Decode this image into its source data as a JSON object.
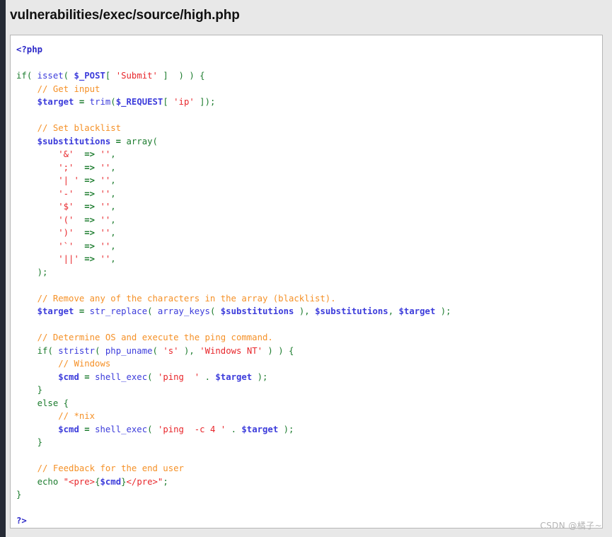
{
  "page": {
    "title": "vulnerabilities/exec/source/high.php",
    "watermark": "CSDN @橘子~"
  },
  "colors": {
    "page_background": "#e8e8e8",
    "left_rail": "#252a35",
    "code_background": "#ffffff",
    "code_border": "#b6b6b6",
    "title_text": "#111111",
    "token_tag": "#2b28c8",
    "token_keyword": "#1c7c2e",
    "token_function": "#3c3cdb",
    "token_variable": "#3c3cdb",
    "token_string": "#e8272c",
    "token_comment": "#f59128",
    "watermark": "#b4b4b4"
  },
  "code": {
    "language": "php",
    "file_name": "high.php",
    "lines": [
      [
        {
          "t": "<?php",
          "c": "tag"
        }
      ],
      [],
      [
        {
          "t": "if",
          "c": "kw"
        },
        {
          "t": "( ",
          "c": "pun"
        },
        {
          "t": "isset",
          "c": "fn"
        },
        {
          "t": "( ",
          "c": "pun"
        },
        {
          "t": "$_POST",
          "c": "var"
        },
        {
          "t": "[ ",
          "c": "pun"
        },
        {
          "t": "'Submit'",
          "c": "str"
        },
        {
          "t": " ]  ) ) {",
          "c": "pun"
        }
      ],
      [
        {
          "t": "    ",
          "c": "plain"
        },
        {
          "t": "// Get input",
          "c": "com"
        }
      ],
      [
        {
          "t": "    ",
          "c": "plain"
        },
        {
          "t": "$target",
          "c": "var"
        },
        {
          "t": " = ",
          "c": "op"
        },
        {
          "t": "trim",
          "c": "fn"
        },
        {
          "t": "(",
          "c": "pun"
        },
        {
          "t": "$_REQUEST",
          "c": "var"
        },
        {
          "t": "[ ",
          "c": "pun"
        },
        {
          "t": "'ip'",
          "c": "str"
        },
        {
          "t": " ]);",
          "c": "pun"
        }
      ],
      [],
      [
        {
          "t": "    ",
          "c": "plain"
        },
        {
          "t": "// Set blacklist",
          "c": "com"
        }
      ],
      [
        {
          "t": "    ",
          "c": "plain"
        },
        {
          "t": "$substitutions",
          "c": "var"
        },
        {
          "t": " = ",
          "c": "op"
        },
        {
          "t": "array",
          "c": "kw"
        },
        {
          "t": "(",
          "c": "pun"
        }
      ],
      [
        {
          "t": "        ",
          "c": "plain"
        },
        {
          "t": "'&'",
          "c": "str"
        },
        {
          "t": "  ",
          "c": "plain"
        },
        {
          "t": "=>",
          "c": "op"
        },
        {
          "t": " ",
          "c": "plain"
        },
        {
          "t": "''",
          "c": "str"
        },
        {
          "t": ",",
          "c": "pun"
        }
      ],
      [
        {
          "t": "        ",
          "c": "plain"
        },
        {
          "t": "';'",
          "c": "str"
        },
        {
          "t": "  ",
          "c": "plain"
        },
        {
          "t": "=>",
          "c": "op"
        },
        {
          "t": " ",
          "c": "plain"
        },
        {
          "t": "''",
          "c": "str"
        },
        {
          "t": ",",
          "c": "pun"
        }
      ],
      [
        {
          "t": "        ",
          "c": "plain"
        },
        {
          "t": "'| '",
          "c": "str"
        },
        {
          "t": " ",
          "c": "plain"
        },
        {
          "t": "=>",
          "c": "op"
        },
        {
          "t": " ",
          "c": "plain"
        },
        {
          "t": "''",
          "c": "str"
        },
        {
          "t": ",",
          "c": "pun"
        }
      ],
      [
        {
          "t": "        ",
          "c": "plain"
        },
        {
          "t": "'-'",
          "c": "str"
        },
        {
          "t": "  ",
          "c": "plain"
        },
        {
          "t": "=>",
          "c": "op"
        },
        {
          "t": " ",
          "c": "plain"
        },
        {
          "t": "''",
          "c": "str"
        },
        {
          "t": ",",
          "c": "pun"
        }
      ],
      [
        {
          "t": "        ",
          "c": "plain"
        },
        {
          "t": "'$'",
          "c": "str"
        },
        {
          "t": "  ",
          "c": "plain"
        },
        {
          "t": "=>",
          "c": "op"
        },
        {
          "t": " ",
          "c": "plain"
        },
        {
          "t": "''",
          "c": "str"
        },
        {
          "t": ",",
          "c": "pun"
        }
      ],
      [
        {
          "t": "        ",
          "c": "plain"
        },
        {
          "t": "'('",
          "c": "str"
        },
        {
          "t": "  ",
          "c": "plain"
        },
        {
          "t": "=>",
          "c": "op"
        },
        {
          "t": " ",
          "c": "plain"
        },
        {
          "t": "''",
          "c": "str"
        },
        {
          "t": ",",
          "c": "pun"
        }
      ],
      [
        {
          "t": "        ",
          "c": "plain"
        },
        {
          "t": "')'",
          "c": "str"
        },
        {
          "t": "  ",
          "c": "plain"
        },
        {
          "t": "=>",
          "c": "op"
        },
        {
          "t": " ",
          "c": "plain"
        },
        {
          "t": "''",
          "c": "str"
        },
        {
          "t": ",",
          "c": "pun"
        }
      ],
      [
        {
          "t": "        ",
          "c": "plain"
        },
        {
          "t": "'`'",
          "c": "str"
        },
        {
          "t": "  ",
          "c": "plain"
        },
        {
          "t": "=>",
          "c": "op"
        },
        {
          "t": " ",
          "c": "plain"
        },
        {
          "t": "''",
          "c": "str"
        },
        {
          "t": ",",
          "c": "pun"
        }
      ],
      [
        {
          "t": "        ",
          "c": "plain"
        },
        {
          "t": "'||'",
          "c": "str"
        },
        {
          "t": " ",
          "c": "plain"
        },
        {
          "t": "=>",
          "c": "op"
        },
        {
          "t": " ",
          "c": "plain"
        },
        {
          "t": "''",
          "c": "str"
        },
        {
          "t": ",",
          "c": "pun"
        }
      ],
      [
        {
          "t": "    ",
          "c": "plain"
        },
        {
          "t": ");",
          "c": "pun"
        }
      ],
      [],
      [
        {
          "t": "    ",
          "c": "plain"
        },
        {
          "t": "// Remove any of the characters in the array (blacklist).",
          "c": "com"
        }
      ],
      [
        {
          "t": "    ",
          "c": "plain"
        },
        {
          "t": "$target",
          "c": "var"
        },
        {
          "t": " = ",
          "c": "op"
        },
        {
          "t": "str_replace",
          "c": "fn"
        },
        {
          "t": "( ",
          "c": "pun"
        },
        {
          "t": "array_keys",
          "c": "fn"
        },
        {
          "t": "( ",
          "c": "pun"
        },
        {
          "t": "$substitutions",
          "c": "var"
        },
        {
          "t": " ), ",
          "c": "pun"
        },
        {
          "t": "$substitutions",
          "c": "var"
        },
        {
          "t": ", ",
          "c": "pun"
        },
        {
          "t": "$target",
          "c": "var"
        },
        {
          "t": " );",
          "c": "pun"
        }
      ],
      [],
      [
        {
          "t": "    ",
          "c": "plain"
        },
        {
          "t": "// Determine OS and execute the ping command.",
          "c": "com"
        }
      ],
      [
        {
          "t": "    ",
          "c": "plain"
        },
        {
          "t": "if",
          "c": "kw"
        },
        {
          "t": "( ",
          "c": "pun"
        },
        {
          "t": "stristr",
          "c": "fn"
        },
        {
          "t": "( ",
          "c": "pun"
        },
        {
          "t": "php_uname",
          "c": "fn"
        },
        {
          "t": "( ",
          "c": "pun"
        },
        {
          "t": "'s'",
          "c": "str"
        },
        {
          "t": " ), ",
          "c": "pun"
        },
        {
          "t": "'Windows NT'",
          "c": "str"
        },
        {
          "t": " ) ) {",
          "c": "pun"
        }
      ],
      [
        {
          "t": "        ",
          "c": "plain"
        },
        {
          "t": "// Windows",
          "c": "com"
        }
      ],
      [
        {
          "t": "        ",
          "c": "plain"
        },
        {
          "t": "$cmd",
          "c": "var"
        },
        {
          "t": " = ",
          "c": "op"
        },
        {
          "t": "shell_exec",
          "c": "fn"
        },
        {
          "t": "( ",
          "c": "pun"
        },
        {
          "t": "'ping  '",
          "c": "str"
        },
        {
          "t": " . ",
          "c": "pun"
        },
        {
          "t": "$target",
          "c": "var"
        },
        {
          "t": " );",
          "c": "pun"
        }
      ],
      [
        {
          "t": "    ",
          "c": "plain"
        },
        {
          "t": "}",
          "c": "pun"
        }
      ],
      [
        {
          "t": "    ",
          "c": "plain"
        },
        {
          "t": "else",
          "c": "kw"
        },
        {
          "t": " {",
          "c": "pun"
        }
      ],
      [
        {
          "t": "        ",
          "c": "plain"
        },
        {
          "t": "// *nix",
          "c": "com"
        }
      ],
      [
        {
          "t": "        ",
          "c": "plain"
        },
        {
          "t": "$cmd",
          "c": "var"
        },
        {
          "t": " = ",
          "c": "op"
        },
        {
          "t": "shell_exec",
          "c": "fn"
        },
        {
          "t": "( ",
          "c": "pun"
        },
        {
          "t": "'ping  -c 4 '",
          "c": "str"
        },
        {
          "t": " . ",
          "c": "pun"
        },
        {
          "t": "$target",
          "c": "var"
        },
        {
          "t": " );",
          "c": "pun"
        }
      ],
      [
        {
          "t": "    ",
          "c": "plain"
        },
        {
          "t": "}",
          "c": "pun"
        }
      ],
      [],
      [
        {
          "t": "    ",
          "c": "plain"
        },
        {
          "t": "// Feedback for the end user",
          "c": "com"
        }
      ],
      [
        {
          "t": "    ",
          "c": "plain"
        },
        {
          "t": "echo",
          "c": "kw"
        },
        {
          "t": " ",
          "c": "plain"
        },
        {
          "t": "\"<pre>",
          "c": "str"
        },
        {
          "t": "{",
          "c": "pun"
        },
        {
          "t": "$cmd",
          "c": "var"
        },
        {
          "t": "}",
          "c": "pun"
        },
        {
          "t": "</pre>\"",
          "c": "str"
        },
        {
          "t": ";",
          "c": "pun"
        }
      ],
      [
        {
          "t": "}",
          "c": "pun"
        }
      ],
      [],
      [
        {
          "t": "?>",
          "c": "tag"
        }
      ]
    ]
  }
}
